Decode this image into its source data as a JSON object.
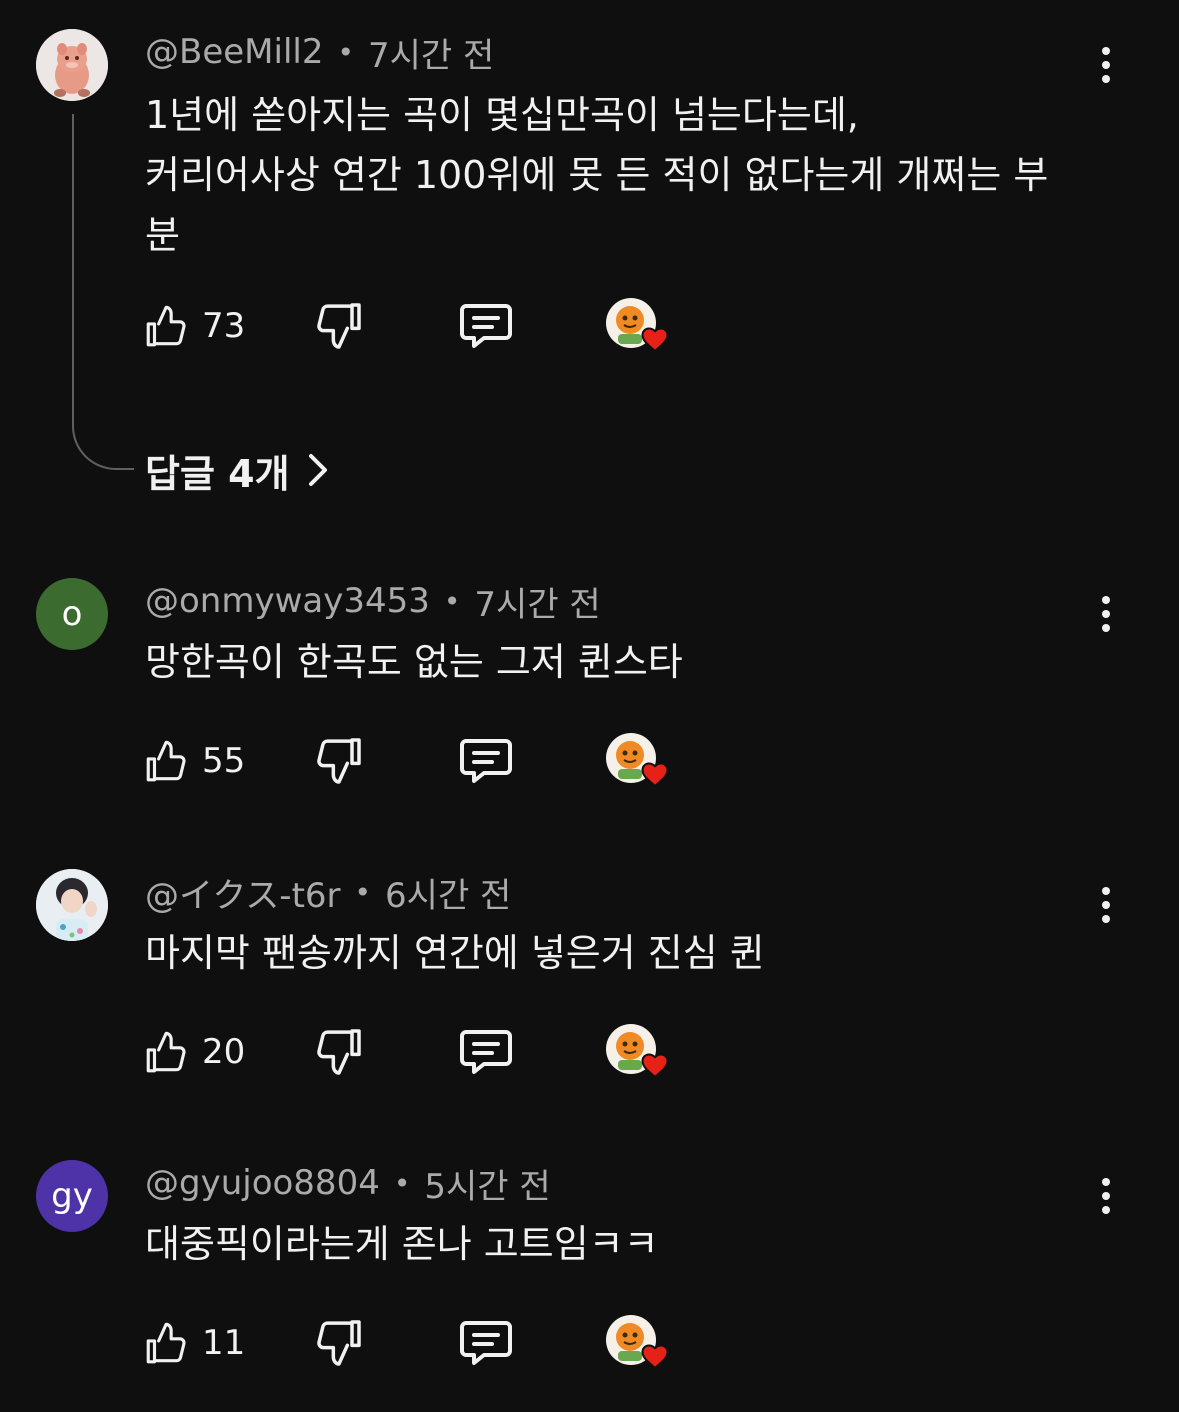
{
  "colors": {
    "background": "#0f0f0f",
    "text_primary": "#f1f1f1",
    "text_secondary": "#aaaaaa",
    "heart": "#e62117",
    "avatar_onmyway": "#3b6b2e",
    "avatar_gyujoo": "#4e33a8"
  },
  "icons": {
    "like": "thumbs-up-icon",
    "dislike": "thumbs-down-icon",
    "reply": "comment-bubble-icon",
    "creator_heart": "creator-heart-icon",
    "more": "more-vertical-icon",
    "chevron": "chevron-right-icon"
  },
  "comments": [
    {
      "author": "@BeeMill2",
      "time": "7시간 전",
      "lines": [
        "1년에 쏟아지는 곡이 몇십만곡이 넘는다는데,",
        "커리어사상 연간 100위에 못 든 적이 없다는게 개쩌는 부",
        "분"
      ],
      "likes": "73",
      "replies_label": "답글 4개"
    },
    {
      "author": "@onmyway3453",
      "time": "7시간 전",
      "avatar_letter": "o",
      "lines": [
        "망한곡이 한곡도 없는 그저 퀸스타"
      ],
      "likes": "55"
    },
    {
      "author": "@イクス-t6r",
      "time": "6시간 전",
      "lines": [
        "마지막 팬송까지 연간에 넣은거 진심 퀸"
      ],
      "likes": "20"
    },
    {
      "author": "@gyujoo8804",
      "time": "5시간 전",
      "avatar_letter": "gy",
      "lines": [
        "대중픽이라는게 존나 고트임ㅋㅋ"
      ],
      "likes": "11"
    }
  ]
}
